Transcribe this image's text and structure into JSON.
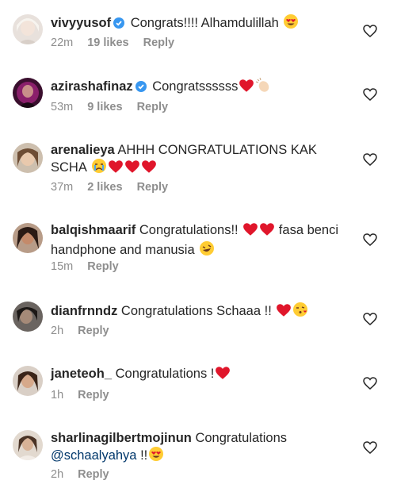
{
  "comments": [
    {
      "username": "vivyyusof",
      "verified": true,
      "text": " Congrats!!!! Alhamdulillah",
      "emojis": [
        "heart-eyes"
      ],
      "time": "22m",
      "likes": "19 likes",
      "reply": "Reply"
    },
    {
      "username": "azirashafinaz",
      "verified": true,
      "text": " Congratssssss",
      "emojis": [
        "red-heart",
        "clap"
      ],
      "time": "53m",
      "likes": "9 likes",
      "reply": "Reply"
    },
    {
      "username": "arenalieya",
      "verified": false,
      "text": " AHHH CONGRATULATIONS KAK SCHA",
      "emojis": [
        "crying-face",
        "red-heart",
        "red-heart",
        "red-heart"
      ],
      "time": "37m",
      "likes": "2 likes",
      "reply": "Reply"
    },
    {
      "username": "balqishmaarif",
      "verified": false,
      "text": " Congratulations!!",
      "emojis_mid": [
        "red-heart",
        "red-heart"
      ],
      "text2": " fasa benci handphone and manusia",
      "emojis": [
        "rofl"
      ],
      "time": "15m",
      "likes": "",
      "reply": "Reply"
    },
    {
      "username": "dianfrnndz",
      "verified": false,
      "text": " Congratulations Schaaa !!",
      "emojis": [
        "red-heart",
        "kissing-heart"
      ],
      "time": "2h",
      "likes": "",
      "reply": "Reply"
    },
    {
      "username": "janeteoh_",
      "verified": false,
      "text": " Congratulations !",
      "emojis": [
        "red-heart"
      ],
      "time": "1h",
      "likes": "",
      "reply": "Reply"
    },
    {
      "username": "sharlinagilbertmojinun",
      "verified": false,
      "text": " Congratulations",
      "mention": "@schaalyahya",
      "text3": " !!",
      "emojis": [
        "heart-eyes"
      ],
      "time": "2h",
      "likes": "",
      "reply": "Reply"
    }
  ],
  "colors": {
    "text": "#262626",
    "meta": "#8e8e8e",
    "mention": "#00376b",
    "verified": "#3897f0",
    "heart": "#e0162b"
  }
}
